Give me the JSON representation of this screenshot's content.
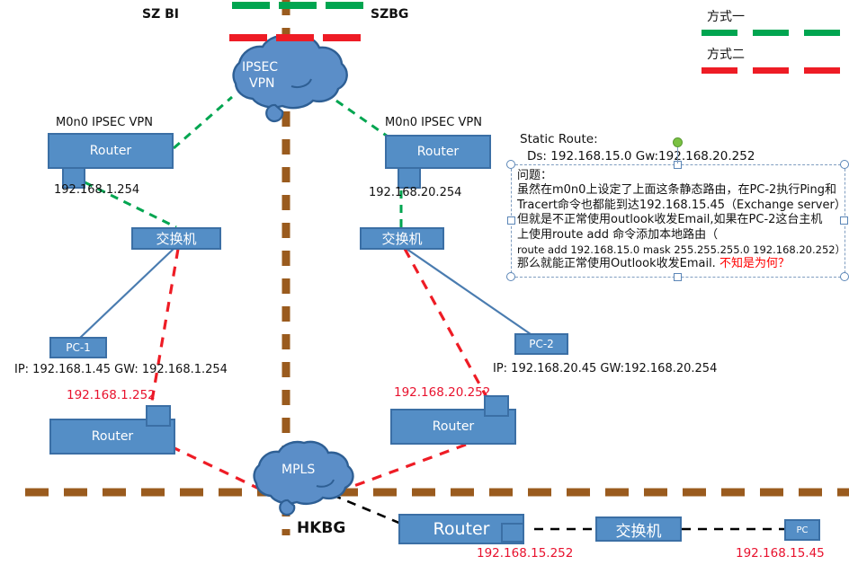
{
  "site_labels": {
    "left": "SZ BI",
    "right": "SZBG",
    "bottom": "HKBG"
  },
  "legend": {
    "method_one": "方式一",
    "method_two": "方式二",
    "method_one_color": "#00a550",
    "method_two_color": "#ee1c25"
  },
  "clouds": {
    "ipsec_line1": "IPSEC",
    "ipsec_line2": "VPN",
    "mpls": "MPLS"
  },
  "left_branch": {
    "router_caption": "M0n0  IPSEC VPN",
    "router_label": "Router",
    "router_ip": "192.168.1.254",
    "switch_label": "交换机",
    "pc_label": "PC-1",
    "pc_ip_line": "IP: 192.168.1.45 GW: 192.168.1.254",
    "mpls_router_label": "Router",
    "mpls_router_ip": "192.168.1.252"
  },
  "right_branch": {
    "router_caption": "M0n0  IPSEC VPN",
    "router_label": "Router",
    "router_ip": "192.168.20.254",
    "switch_label": "交换机",
    "pc_label": "PC-2",
    "pc_ip_line": "IP: 192.168.20.45  GW:192.168.20.254",
    "mpls_router_label": "Router",
    "mpls_router_ip": "192.168.20.252"
  },
  "hk_branch": {
    "router_label": "Router",
    "router_ip": "192.168.15.252",
    "switch_label": "交换机",
    "pc_label": "PC",
    "pc_ip": "192.168.15.45"
  },
  "static_route": {
    "line1": "Static Route:",
    "line2": "Ds: 192.168.15.0  Gw:192.168.20.252"
  },
  "note_box": {
    "title": "问题：",
    "line1": "虽然在m0n0上设定了上面这条静态路由，在PC-2执行Ping和",
    "line2": "Tracert命令也都能到达192.168.15.45（Exchange server）",
    "line3": "但就是不正常使用outlook收发Email,如果在PC-2这台主机",
    "line4": "上使用route add 命令添加本地路由（",
    "line5": "route add 192.168.15.0 mask 255.255.255.0 192.168.20.252）",
    "line6_a": "那么就能正常使用Outlook收发Email. ",
    "line6_b": "不知是为何？"
  },
  "colors": {
    "device_fill": "#548ec6",
    "device_stroke": "#3b6fa5",
    "green_dash": "#00a550",
    "red_dash": "#ee1c25",
    "brown_dash": "#9a5b1e",
    "black_dash": "#000000",
    "blue_line": "#4a7cb0"
  }
}
